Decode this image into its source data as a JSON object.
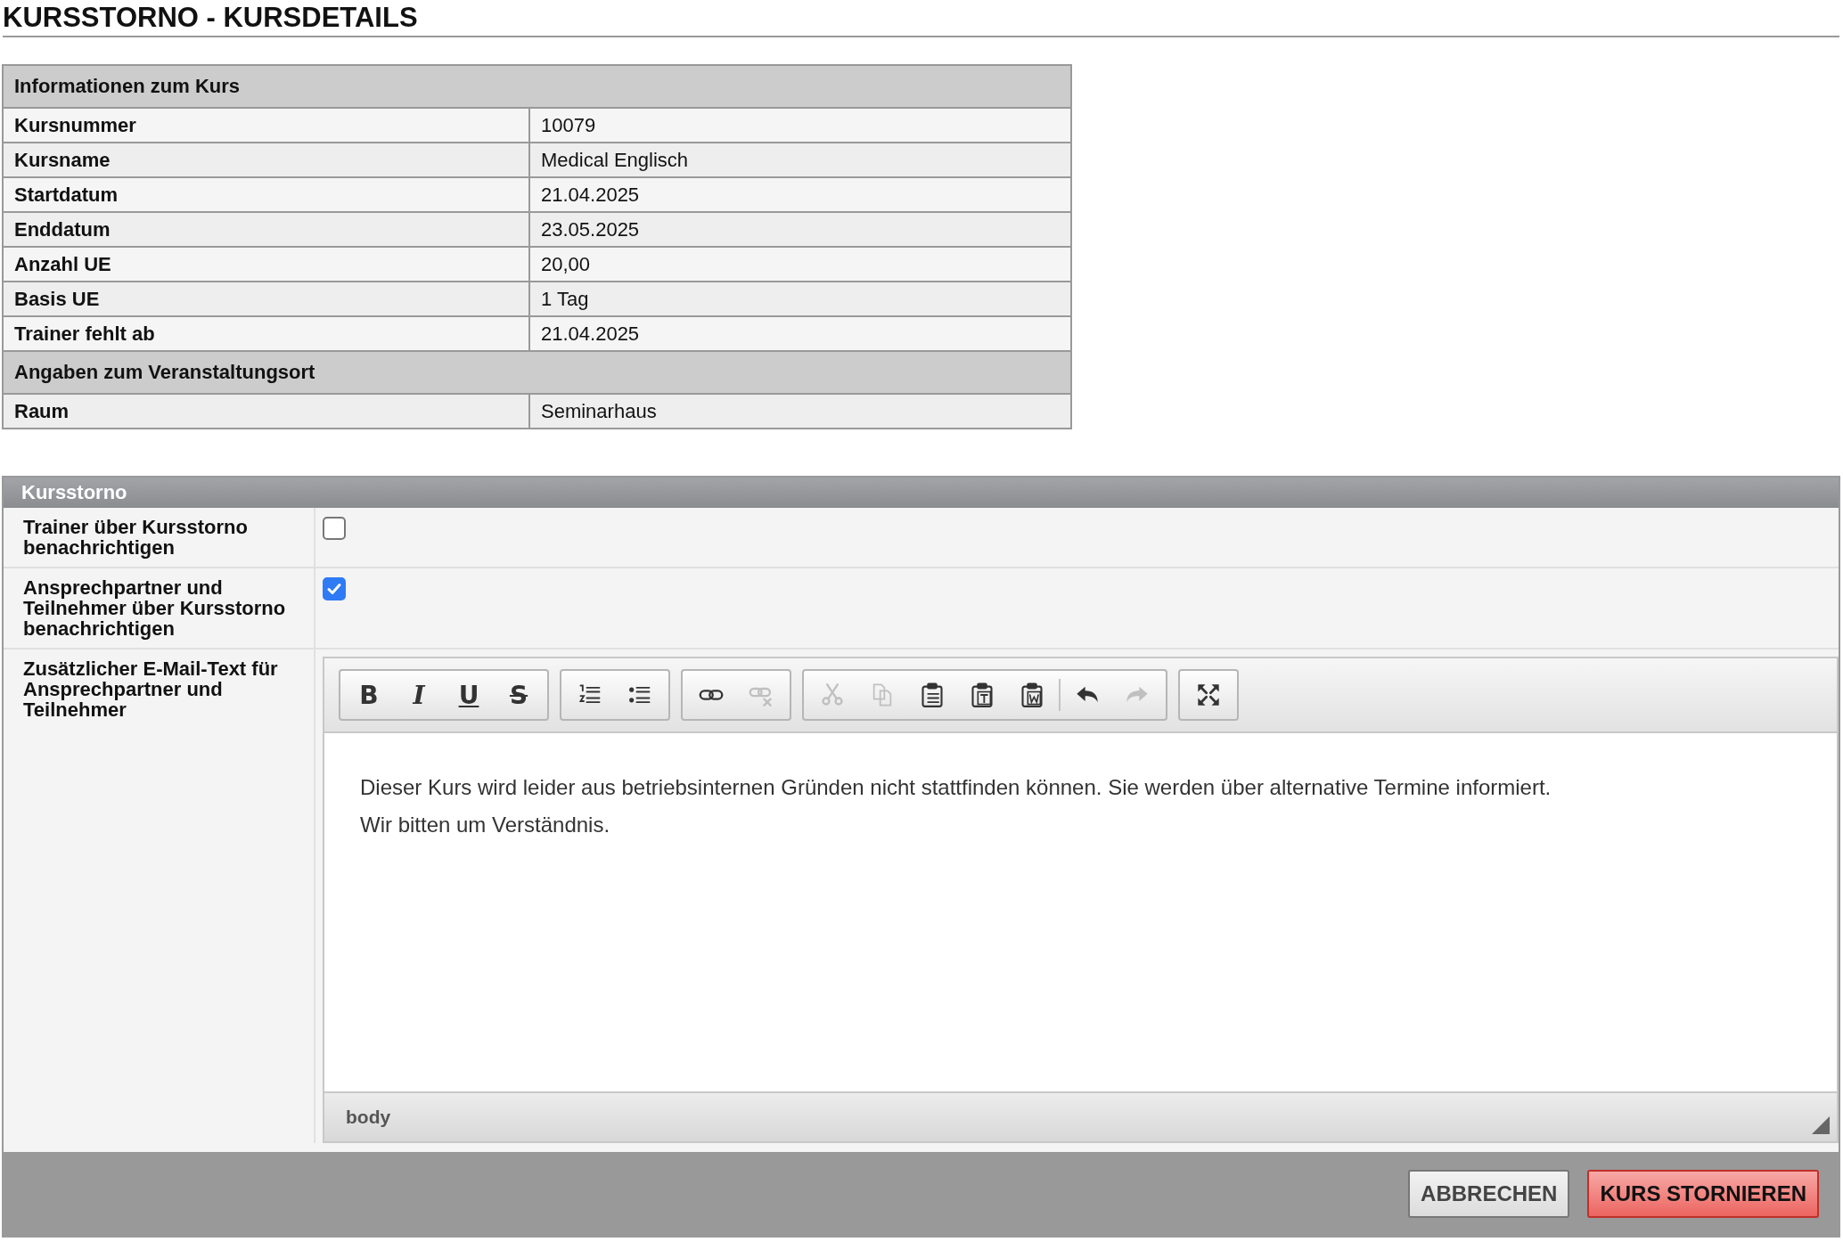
{
  "page_title": "KURSSTORNO - KURSDETAILS",
  "info_table": {
    "sections": [
      {
        "heading": "Informationen zum Kurs",
        "rows": [
          {
            "label": "Kursnummer",
            "value": "10079"
          },
          {
            "label": "Kursname",
            "value": "Medical Englisch"
          },
          {
            "label": "Startdatum",
            "value": "21.04.2025"
          },
          {
            "label": "Enddatum",
            "value": "23.05.2025"
          },
          {
            "label": "Anzahl UE",
            "value": "20,00"
          },
          {
            "label": "Basis UE",
            "value": "1 Tag"
          },
          {
            "label": "Trainer fehlt ab",
            "value": "21.04.2025"
          }
        ]
      },
      {
        "heading": "Angaben zum Veranstaltungsort",
        "rows": [
          {
            "label": "Raum",
            "value": "Seminarhaus"
          }
        ]
      }
    ]
  },
  "storno_panel": {
    "title": "Kursstorno",
    "options": [
      {
        "label": "Trainer über Kursstorno benachrichtigen",
        "checked": false
      },
      {
        "label": "Ansprechpartner und Teilnehmer über Kursstorno benachrichtigen",
        "checked": true
      }
    ],
    "email_text": {
      "label": "Zusätzlicher E-Mail-Text für Ansprechpartner und Teilnehmer",
      "toolbar": [
        [
          {
            "kind": "bold",
            "glyph": "B",
            "disabled": false
          },
          {
            "kind": "italic",
            "glyph": "I",
            "disabled": false
          },
          {
            "kind": "underline",
            "glyph": "U",
            "disabled": false
          },
          {
            "kind": "strike",
            "glyph": "S",
            "disabled": false
          }
        ],
        [
          {
            "kind": "ordered-list",
            "disabled": false
          },
          {
            "kind": "bullet-list",
            "disabled": false
          }
        ],
        [
          {
            "kind": "link",
            "disabled": false
          },
          {
            "kind": "unlink",
            "disabled": true
          }
        ],
        [
          {
            "kind": "cut",
            "disabled": true
          },
          {
            "kind": "copy",
            "disabled": true
          },
          {
            "kind": "paste",
            "disabled": false
          },
          {
            "kind": "paste-text",
            "disabled": false
          },
          {
            "kind": "paste-word",
            "disabled": false
          },
          {
            "kind": "separator"
          },
          {
            "kind": "undo",
            "disabled": false
          },
          {
            "kind": "redo",
            "disabled": true
          }
        ],
        [
          {
            "kind": "maximize",
            "disabled": false
          }
        ]
      ],
      "paragraphs": [
        "Dieser Kurs wird leider aus betriebsinternen Gründen nicht stattfinden können. Sie werden über alternative Termine informiert.",
        "Wir bitten um Verständnis."
      ],
      "path": "body"
    }
  },
  "buttons": [
    {
      "label": "ABBRECHEN",
      "kind": "secondary"
    },
    {
      "label": "KURS STORNIEREN",
      "kind": "primary"
    }
  ]
}
